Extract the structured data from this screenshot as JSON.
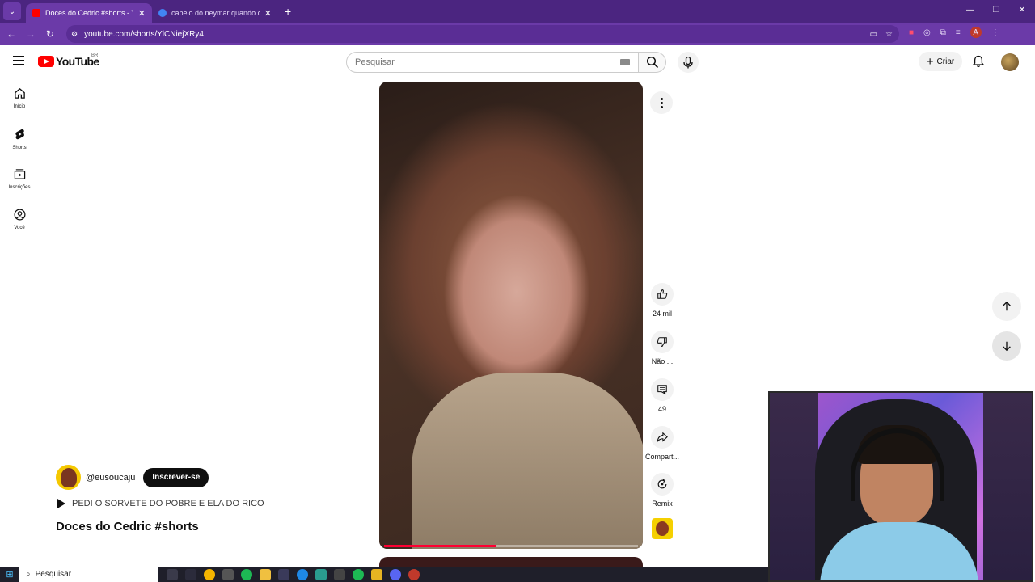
{
  "browser": {
    "tabs": [
      {
        "title": "Doces do Cedric #shorts - YouTube",
        "active": true,
        "favicon_color": "#ff0000"
      },
      {
        "title": "cabelo do neymar quando chegou",
        "active": false,
        "favicon_color": "#4285f4"
      }
    ],
    "url": "youtube.com/shorts/YlCNiejXRy4"
  },
  "youtube": {
    "logo_text": "YouTube",
    "country_code": "BR",
    "search_placeholder": "Pesquisar",
    "create_label": "Criar"
  },
  "sidebar": {
    "items": [
      {
        "label": "Início",
        "icon": "home-icon"
      },
      {
        "label": "Shorts",
        "icon": "shorts-icon"
      },
      {
        "label": "Inscrições",
        "icon": "subscriptions-icon"
      },
      {
        "label": "Você",
        "icon": "you-icon"
      }
    ]
  },
  "short": {
    "progress_fraction": 0.44,
    "actions": {
      "like_count": "24 mil",
      "dislike_label": "Não ...",
      "comment_count": "49",
      "share_label": "Compart...",
      "remix_label": "Remix"
    },
    "channel": {
      "handle": "@eusoucaju",
      "subscribe_label": "Inscrever-se"
    },
    "music": "PEDI O SORVETE DO POBRE E ELA DO RICO",
    "title": "Doces do Cedric #shorts"
  },
  "taskbar": {
    "search_label": "Pesquisar"
  },
  "colors": {
    "browser_frame": "#4b2580",
    "youtube_red": "#ff0000",
    "subscribe_bg": "#0f0f0f"
  }
}
